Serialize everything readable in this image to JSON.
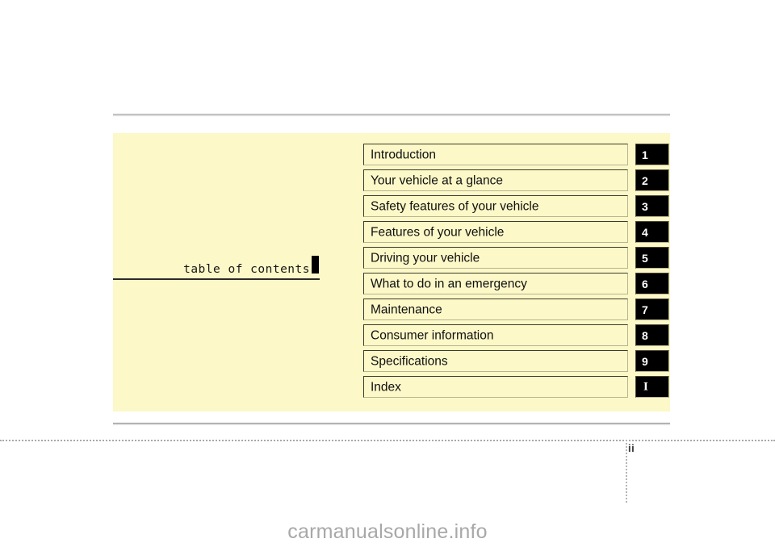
{
  "page": {
    "title": "table of contents",
    "page_number": "ii",
    "watermark": "carmanualsonline.info",
    "panel_color": "#fcf8c8",
    "badge_color": "#000000",
    "badge_text_color": "#ffffff"
  },
  "contents": {
    "rows": [
      {
        "label": "Introduction",
        "badge": "1"
      },
      {
        "label": "Your vehicle at a glance",
        "badge": "2"
      },
      {
        "label": "Safety features of your vehicle",
        "badge": "3"
      },
      {
        "label": "Features of your vehicle",
        "badge": "4"
      },
      {
        "label": "Driving your vehicle",
        "badge": "5"
      },
      {
        "label": "What to do in an emergency",
        "badge": "6"
      },
      {
        "label": "Maintenance",
        "badge": "7"
      },
      {
        "label": "Consumer information",
        "badge": "8"
      },
      {
        "label": "Specifications",
        "badge": "9"
      },
      {
        "label": "Index",
        "badge": "I"
      }
    ]
  }
}
